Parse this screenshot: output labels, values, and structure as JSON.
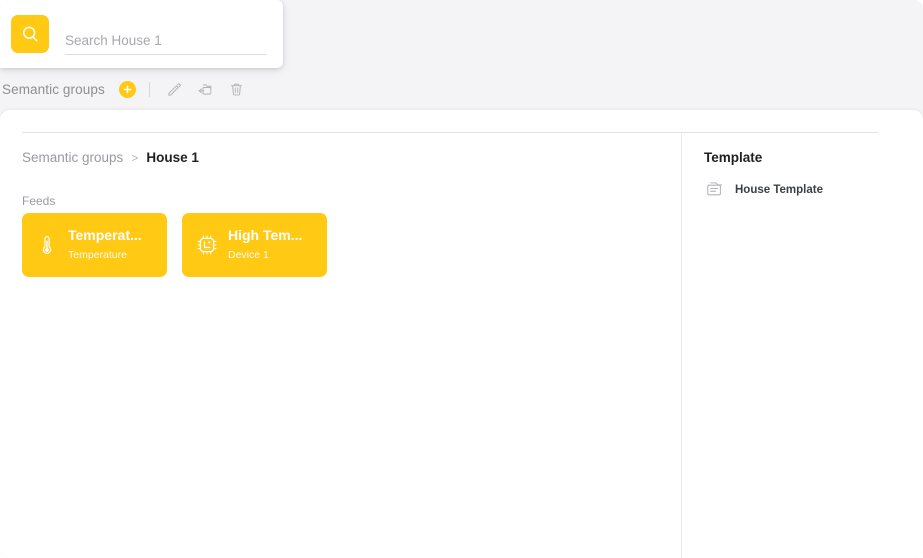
{
  "colors": {
    "accent": "#ffc914",
    "page_background": "#f4f3f5",
    "card_background": "#ffffff",
    "muted_text": "#9a9aa0",
    "dark_text": "#202124"
  },
  "search": {
    "button_icon": "search-icon",
    "placeholder": "Search House 1",
    "value": ""
  },
  "toolbar": {
    "title": "Semantic groups",
    "add_label": "+",
    "actions": [
      {
        "name": "edit-icon",
        "tooltip": "Edit"
      },
      {
        "name": "move-icon",
        "tooltip": "Move"
      },
      {
        "name": "delete-icon",
        "tooltip": "Delete"
      }
    ]
  },
  "breadcrumb": {
    "root": "Semantic groups",
    "separator": ">",
    "current": "House 1"
  },
  "main": {
    "section_label": "Feeds",
    "feeds": [
      {
        "title": "Temperat...",
        "subtitle": "Temperature",
        "icon": "thermometer-icon"
      },
      {
        "title": "High Tem...",
        "subtitle": "Device 1",
        "icon": "device-chip-icon"
      }
    ]
  },
  "template_panel": {
    "heading": "Template",
    "items": [
      {
        "label": "House Template",
        "icon": "template-document-icon"
      }
    ]
  }
}
